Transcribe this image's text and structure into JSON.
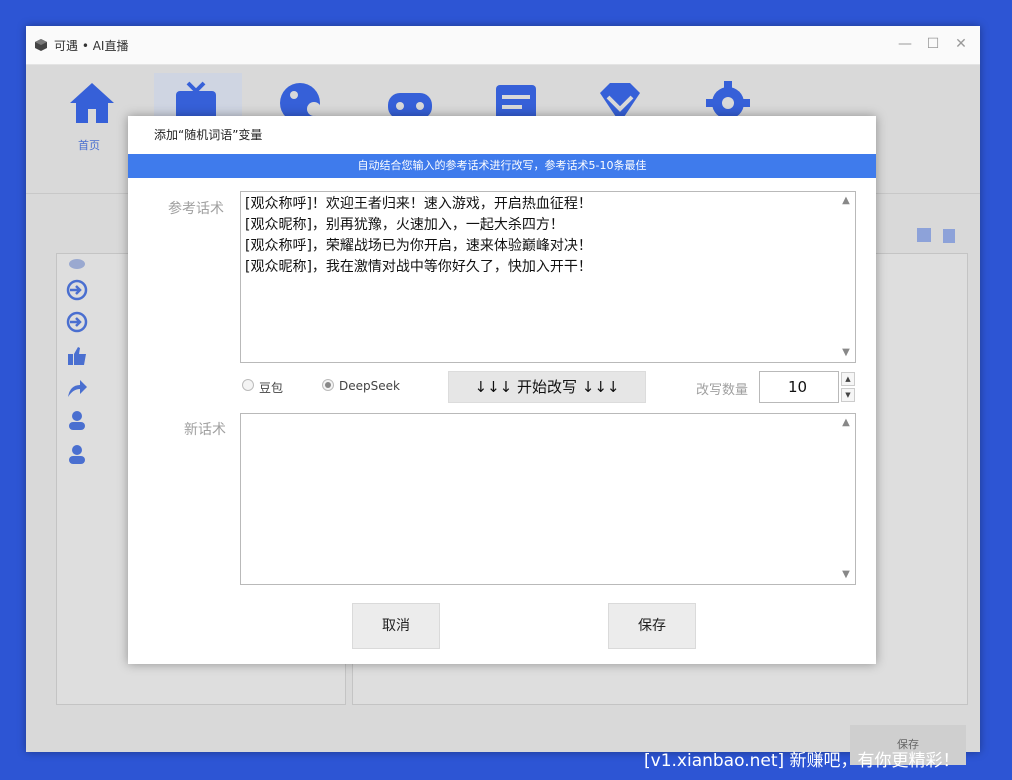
{
  "window": {
    "title": "可遇 • AI直播"
  },
  "background": {
    "nav_label_home": "首页",
    "save_label": "保存"
  },
  "dialog": {
    "title": "添加“随机词语”变量",
    "banner": "自动结合您输入的参考话术进行改写，参考话术5-10条最佳",
    "reference_label": "参考话术",
    "reference_lines": [
      "[观众称呼]！欢迎王者归来！速入游戏，开启热血征程！",
      "[观众昵称]，别再犹豫，火速加入，一起大杀四方！",
      "[观众称呼]，荣耀战场已为你开启，速来体验巅峰对决！",
      "[观众昵称]，我在激情对战中等你好久了，快加入开干！"
    ],
    "model_options": [
      {
        "label": "豆包",
        "selected": false
      },
      {
        "label": "DeepSeek",
        "selected": true
      }
    ],
    "rewrite_button": "↓↓↓ 开始改写 ↓↓↓",
    "count_label": "改写数量",
    "count_value": "10",
    "new_label": "新话术",
    "new_text": "",
    "cancel_button": "取消",
    "save_button": "保存"
  },
  "watermark": "[v1.xianbao.net] 新赚吧，有你更精彩！",
  "colors": {
    "backdrop": "#2d55d4",
    "banner": "#3f7bec",
    "icon_blue": "#3660d8"
  },
  "icons": [
    "home-icon",
    "tv-icon",
    "game-icon",
    "gamepad-icon",
    "list-icon",
    "diamond-icon",
    "gear-icon"
  ]
}
